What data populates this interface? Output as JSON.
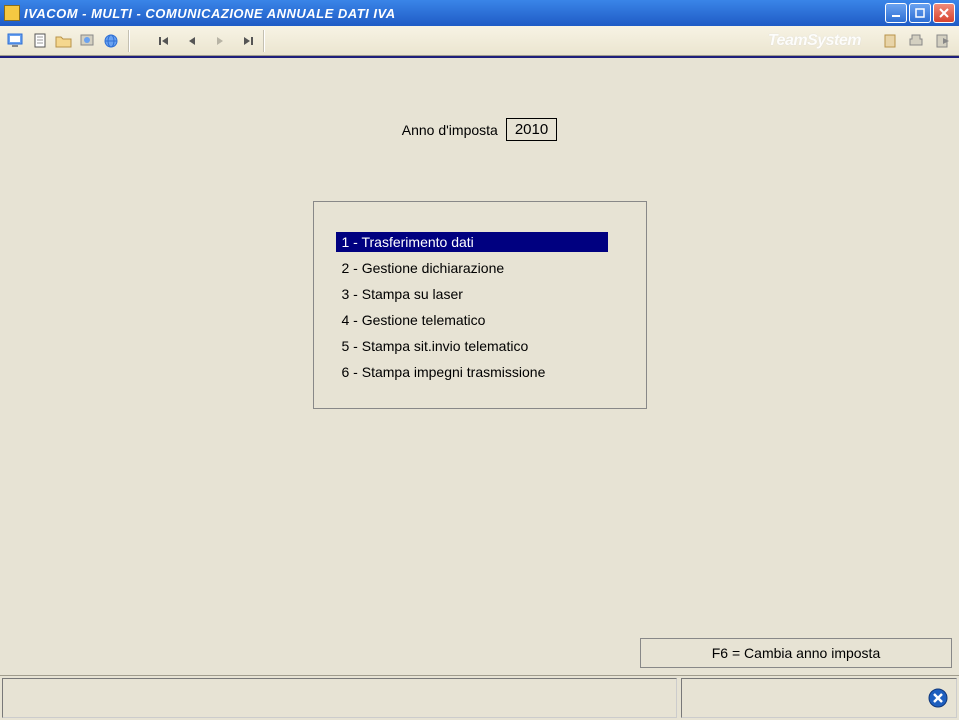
{
  "titlebar": {
    "text": "IVACOM  - MULTI -  COMUNICAZIONE ANNUALE DATI IVA"
  },
  "brand": "TeamSystem",
  "year": {
    "label": "Anno d'imposta",
    "value": "2010"
  },
  "menu": {
    "items": [
      {
        "label": "1 - Trasferimento dati",
        "selected": true
      },
      {
        "label": "2 - Gestione dichiarazione",
        "selected": false
      },
      {
        "label": "3 - Stampa su laser",
        "selected": false
      },
      {
        "label": "4 - Gestione telematico",
        "selected": false
      },
      {
        "label": "5 - Stampa sit.invio telematico",
        "selected": false
      },
      {
        "label": "6 - Stampa impegni trasmissione",
        "selected": false
      }
    ]
  },
  "hint": "F6 = Cambia anno imposta"
}
